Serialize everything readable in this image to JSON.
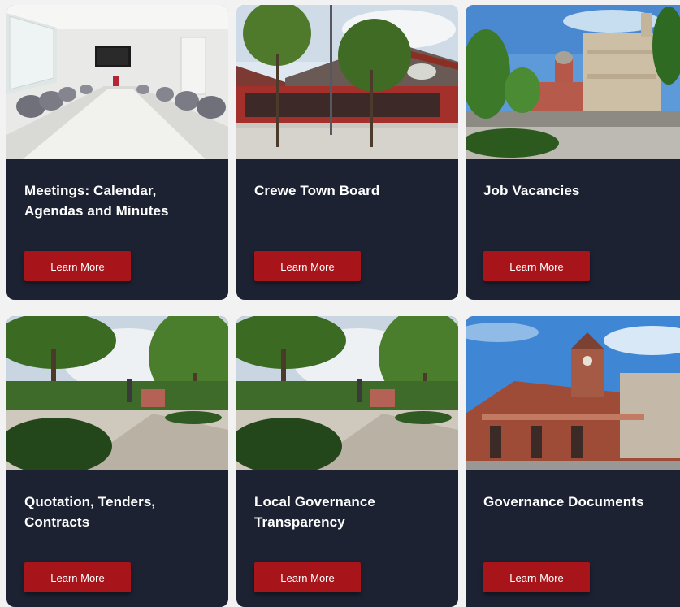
{
  "cards": [
    {
      "title": "Meetings: Calendar, Agendas and Minutes",
      "button": "Learn More",
      "image": "boardroom-photo"
    },
    {
      "title": "Crewe Town Board",
      "button": "Learn More",
      "image": "market-hall-photo"
    },
    {
      "title": "Job Vacancies",
      "button": "Learn More",
      "image": "municipal-buildings-photo"
    },
    {
      "title": "Quotation, Tenders, Contracts",
      "button": "Learn More",
      "image": "town-square-photo"
    },
    {
      "title": "Local Governance Transparency",
      "button": "Learn More",
      "image": "town-square-photo"
    },
    {
      "title": "Governance Documents",
      "button": "Learn More",
      "image": "market-hall-facade-photo"
    }
  ],
  "colors": {
    "card_bg": "#1d2233",
    "button_bg": "#a71419",
    "page_bg": "#f2f2f2",
    "text": "#ffffff"
  }
}
